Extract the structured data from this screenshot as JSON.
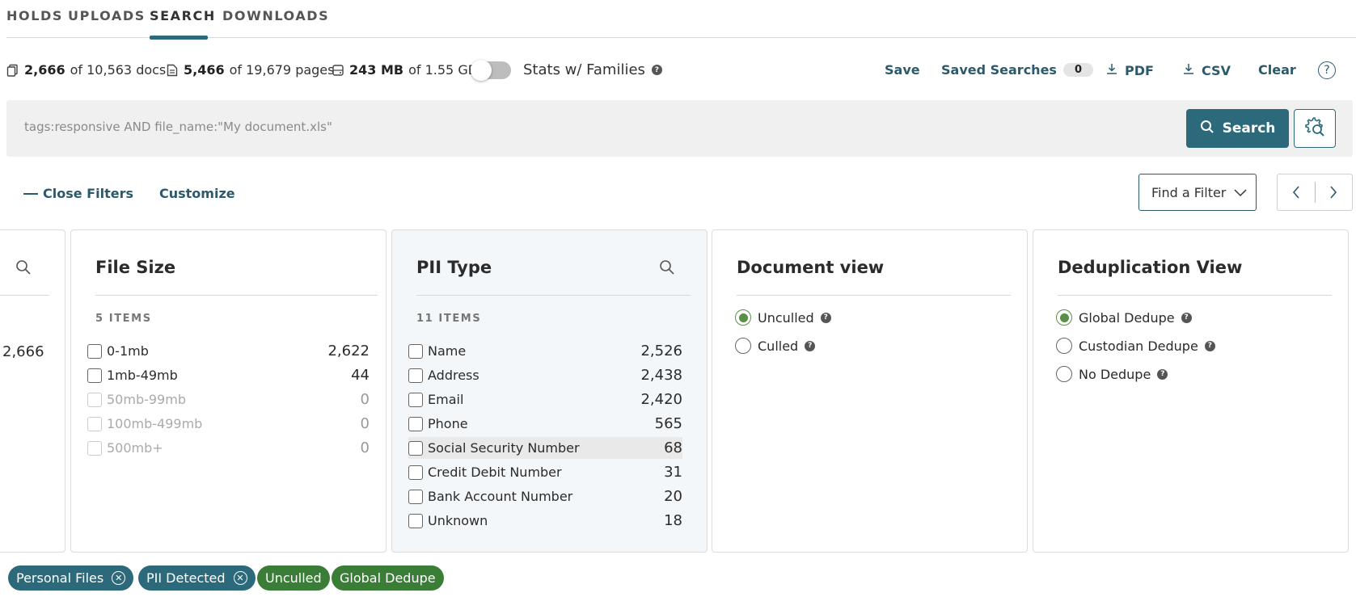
{
  "tabs": [
    "HOLDS",
    "UPLOADS",
    "SEARCH",
    "DOWNLOADS"
  ],
  "active_tab": "SEARCH",
  "stats": {
    "docs_count": "2,666",
    "docs_total": "of 10,563 docs",
    "pages_count": "5,466",
    "pages_total": "of 19,679 pages",
    "size_count": "243 MB",
    "size_total": "of 1.55 GB",
    "families_label": "Stats w/ Families",
    "families_enabled": false
  },
  "actions": {
    "save": "Save",
    "saved_searches": "Saved Searches",
    "saved_searches_count": "0",
    "pdf": "PDF",
    "csv": "CSV",
    "clear": "Clear"
  },
  "search": {
    "placeholder": "tags:responsive AND file_name:\"My document.xls\"",
    "button": "Search"
  },
  "filters_bar": {
    "close_filters": "Close Filters",
    "customize": "Customize",
    "find_filter": "Find a Filter"
  },
  "partial_card": {
    "value": "2,666"
  },
  "file_size": {
    "title": "File Size",
    "items_count": "5 ITEMS",
    "rows": [
      {
        "label": "0-1mb",
        "count": "2,622",
        "disabled": false
      },
      {
        "label": "1mb-49mb",
        "count": "44",
        "disabled": false
      },
      {
        "label": "50mb-99mb",
        "count": "0",
        "disabled": true
      },
      {
        "label": "100mb-499mb",
        "count": "0",
        "disabled": true
      },
      {
        "label": "500mb+",
        "count": "0",
        "disabled": true
      }
    ]
  },
  "pii_type": {
    "title": "PII Type",
    "items_count": "11 ITEMS",
    "rows": [
      {
        "label": "Name",
        "count": "2,526"
      },
      {
        "label": "Address",
        "count": "2,438"
      },
      {
        "label": "Email",
        "count": "2,420"
      },
      {
        "label": "Phone",
        "count": "565"
      },
      {
        "label": "Social Security Number",
        "count": "68"
      },
      {
        "label": "Credit Debit Number",
        "count": "31"
      },
      {
        "label": "Bank Account Number",
        "count": "20"
      },
      {
        "label": "Unknown",
        "count": "18"
      }
    ]
  },
  "document_view": {
    "title": "Document view",
    "options": [
      {
        "label": "Unculled",
        "selected": true
      },
      {
        "label": "Culled",
        "selected": false
      }
    ]
  },
  "dedup_view": {
    "title": "Deduplication View",
    "options": [
      {
        "label": "Global Dedupe",
        "selected": true
      },
      {
        "label": "Custodian Dedupe",
        "selected": false
      },
      {
        "label": "No Dedupe",
        "selected": false
      }
    ]
  },
  "chips": [
    {
      "label": "Personal Files",
      "removable": true,
      "color": "#2c6a7b"
    },
    {
      "label": "PII Detected",
      "removable": true,
      "color": "#2c6a7b"
    },
    {
      "label": "Unculled",
      "removable": false,
      "color": "#3a7d36"
    },
    {
      "label": "Global Dedupe",
      "removable": false,
      "color": "#3a7d36"
    }
  ]
}
